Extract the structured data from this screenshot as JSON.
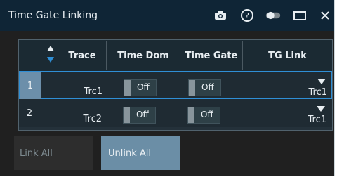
{
  "window": {
    "title": "Time Gate Linking",
    "toolbar_icons": [
      "camera-icon",
      "help-icon",
      "toggle-icon",
      "maximize-icon",
      "close-icon"
    ]
  },
  "table": {
    "columns": [
      "Trace",
      "Time Dom",
      "Time Gate",
      "TG Link"
    ],
    "rows": [
      {
        "index": "1",
        "trace": "Trc1",
        "time_dom": "Off",
        "time_gate": "Off",
        "tg_link": "Trc1"
      },
      {
        "index": "2",
        "trace": "Trc2",
        "time_dom": "Off",
        "time_gate": "Off",
        "tg_link": "Trc1"
      }
    ]
  },
  "buttons": {
    "link_all": "Link All",
    "unlink_all": "Unlink All"
  },
  "colors": {
    "titlebar": "#0f2536",
    "selected_row_border": "#2f8fd6",
    "selected_index_bg": "#6c8faa"
  }
}
